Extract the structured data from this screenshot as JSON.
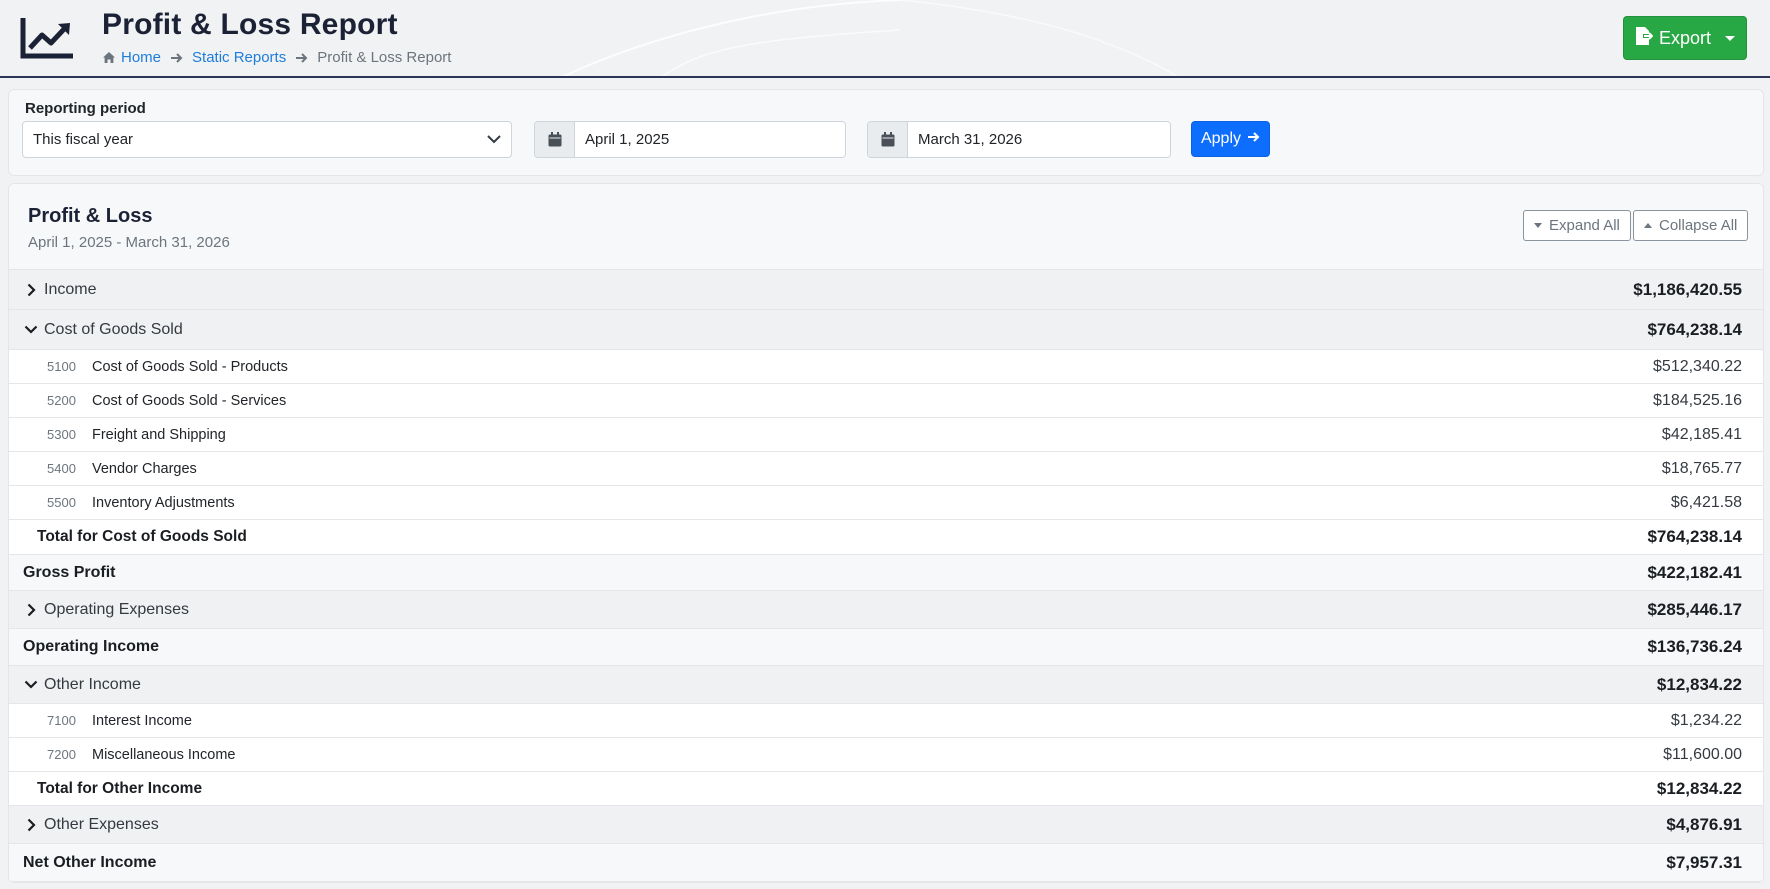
{
  "header": {
    "title": "Profit & Loss Report",
    "logo_icon": "chart-line-icon",
    "breadcrumb": {
      "home": "Home",
      "static_reports": "Static Reports",
      "current": "Profit & Loss Report"
    },
    "export_label": "Export"
  },
  "filters": {
    "label": "Reporting period",
    "period_selected": "This fiscal year",
    "start_date": "April 1, 2025",
    "end_date": "March 31, 2026",
    "apply_label": "Apply"
  },
  "report": {
    "title": "Profit & Loss",
    "range": "April 1, 2025 - March 31, 2026",
    "expand_all": "Expand All",
    "collapse_all": "Collapse All",
    "income": {
      "label": "Income",
      "amount": "$1,186,420.55",
      "expanded": false
    },
    "cogs": {
      "label": "Cost of Goods Sold",
      "amount": "$764,238.14",
      "expanded": true,
      "accounts": [
        {
          "code": "5100",
          "name": "Cost of Goods Sold - Products",
          "amount": "$512,340.22"
        },
        {
          "code": "5200",
          "name": "Cost of Goods Sold - Services",
          "amount": "$184,525.16"
        },
        {
          "code": "5300",
          "name": "Freight and Shipping",
          "amount": "$42,185.41"
        },
        {
          "code": "5400",
          "name": "Vendor Charges",
          "amount": "$18,765.77"
        },
        {
          "code": "5500",
          "name": "Inventory Adjustments",
          "amount": "$6,421.58"
        }
      ],
      "total_label": "Total for Cost of Goods Sold",
      "total_amount": "$764,238.14"
    },
    "gross_profit": {
      "label": "Gross Profit",
      "amount": "$422,182.41"
    },
    "operating_expenses": {
      "label": "Operating Expenses",
      "amount": "$285,446.17",
      "expanded": false
    },
    "operating_income": {
      "label": "Operating Income",
      "amount": "$136,736.24"
    },
    "other_income": {
      "label": "Other Income",
      "amount": "$12,834.22",
      "expanded": true,
      "accounts": [
        {
          "code": "7100",
          "name": "Interest Income",
          "amount": "$1,234.22"
        },
        {
          "code": "7200",
          "name": "Miscellaneous Income",
          "amount": "$11,600.00"
        }
      ],
      "total_label": "Total for Other Income",
      "total_amount": "$12,834.22"
    },
    "other_expenses": {
      "label": "Other Expenses",
      "amount": "$4,876.91",
      "expanded": false
    },
    "net_other_income": {
      "label": "Net Other Income",
      "amount": "$7,957.31"
    }
  },
  "colors": {
    "brand_dark": "#1c2235",
    "link": "#1e7ddb",
    "export_green": "#28a745",
    "apply_blue": "#0d6efd"
  }
}
